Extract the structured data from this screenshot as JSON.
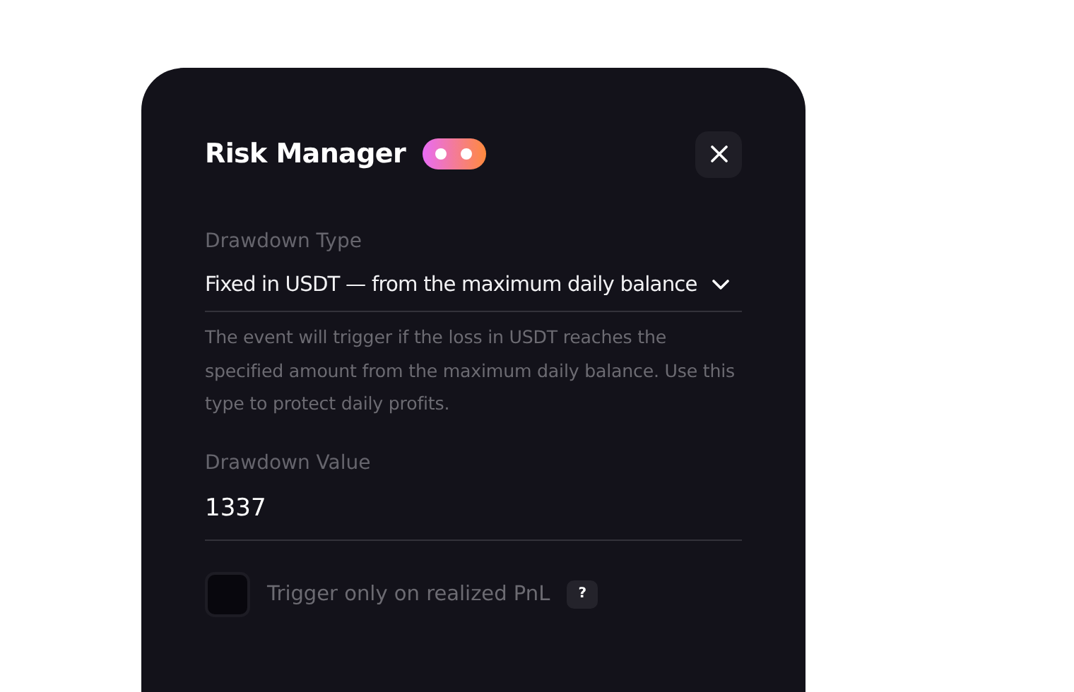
{
  "dialog": {
    "title": "Risk Manager",
    "drawdown_type": {
      "label": "Drawdown Type",
      "value": "Fixed in USDT — from the maximum daily balance",
      "description": "The event will trigger if the loss in USDT reaches the specified amount from the maximum daily balance. Use this type to protect daily profits."
    },
    "drawdown_value": {
      "label": "Drawdown Value",
      "value": "1337"
    },
    "realized_pnl": {
      "label": "Trigger only on realized PnL",
      "checked": false,
      "help": "?"
    }
  }
}
